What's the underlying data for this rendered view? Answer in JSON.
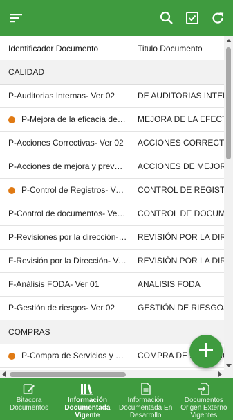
{
  "colors": {
    "primary": "#3f9b3f",
    "status_dot": "#e07a14",
    "group_bg": "#f2f2f2"
  },
  "toolbar": {
    "menu_icon": "menu-icon",
    "search_icon": "search-icon",
    "check_icon": "checkbox-icon",
    "refresh_icon": "refresh-icon"
  },
  "table": {
    "columns": [
      "Identificador Documento",
      "Titulo Documento"
    ],
    "groups": [
      {
        "name": "CALIDAD",
        "rows": [
          {
            "id": "P-Auditorias Internas- Ver 02",
            "title": "DE AUDITORIAS INTERN",
            "dot": false
          },
          {
            "id": "P-Mejora de la eficacia del s...",
            "title": "MEJORA DE LA EFECTIV",
            "dot": true
          },
          {
            "id": "P-Acciones Correctivas- Ver 02",
            "title": "ACCIONES CORRECTIVA",
            "dot": false
          },
          {
            "id": "P-Acciones de mejora y prevent...",
            "title": "ACCIONES DE MEJORA",
            "dot": false
          },
          {
            "id": "P-Control de Registros- Ver ...",
            "title": "CONTROL DE REGISTRO",
            "dot": true
          },
          {
            "id": "P-Control de documentos- Ver 02",
            "title": "CONTROL DE DOCUMEN",
            "dot": false
          },
          {
            "id": "P-Revisiones por la dirección- V...",
            "title": "REVISIÓN POR LA DIREC",
            "dot": false
          },
          {
            "id": "F-Revisión por la Dirección- Ver ...",
            "title": "REVISIÓN POR LA DIREC",
            "dot": false
          },
          {
            "id": "F-Análisis FODA- Ver 01",
            "title": "ANALISIS FODA",
            "dot": false
          },
          {
            "id": "P-Gestión de riesgos- Ver 02",
            "title": "GESTIÓN DE RIESGOS",
            "dot": false
          }
        ]
      },
      {
        "name": "COMPRAS",
        "rows": [
          {
            "id": "P-Compra de Servicios y Su...",
            "title": "COMPRA DE SERVICIOS",
            "dot": true
          }
        ]
      }
    ]
  },
  "fab": {
    "icon": "plus-icon"
  },
  "bottom_nav": [
    {
      "label": "Bitacora Documentos",
      "icon": "edit-icon",
      "active": false
    },
    {
      "label": "Información Documentada Vigente",
      "icon": "library-icon",
      "active": true
    },
    {
      "label": "Información Documentada En Desarrollo",
      "icon": "document-icon",
      "active": false
    },
    {
      "label": "Documentos Origen Externo Vigentes",
      "icon": "external-document-icon",
      "active": false
    }
  ]
}
